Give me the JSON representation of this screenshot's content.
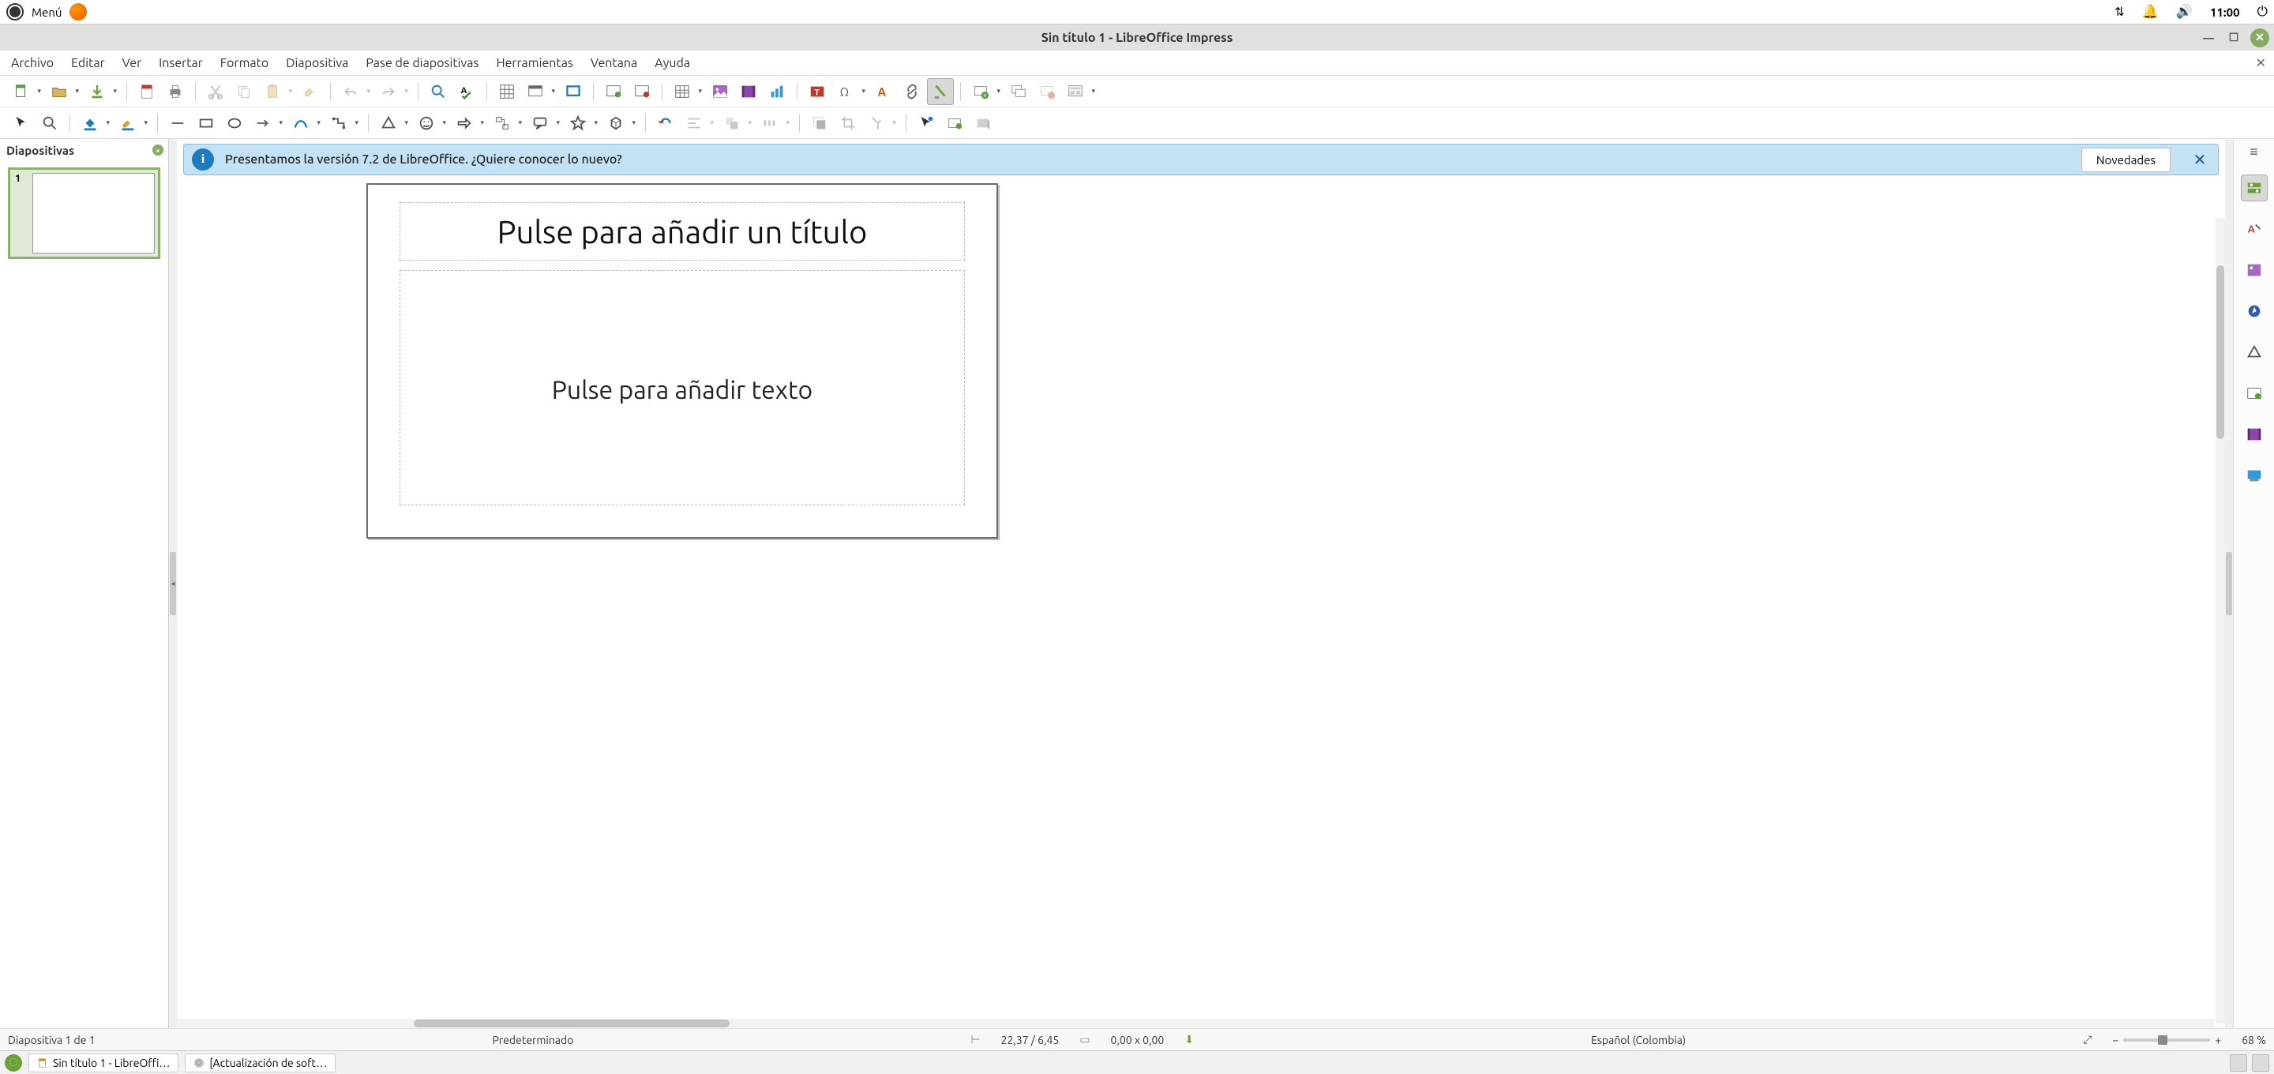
{
  "system": {
    "menu_label": "Menú",
    "clock": "11:00"
  },
  "window": {
    "title": "Sin título 1 - LibreOffice Impress"
  },
  "menus": [
    "Archivo",
    "Editar",
    "Ver",
    "Insertar",
    "Formato",
    "Diapositiva",
    "Pase de diapositivas",
    "Herramientas",
    "Ventana",
    "Ayuda"
  ],
  "slidepanel": {
    "header": "Diapositivas",
    "slides": [
      {
        "num": "1"
      }
    ]
  },
  "infobar": {
    "text": "Presentamos la versión 7.2 de LibreOffice. ¿Quiere conocer lo nuevo?",
    "button": "Novedades"
  },
  "canvas": {
    "title_placeholder": "Pulse para añadir un título",
    "body_placeholder": "Pulse para añadir texto"
  },
  "statusbar": {
    "slideinfo": "Diapositiva 1 de 1",
    "template": "Predeterminado",
    "pos": "22,37 / 6,45",
    "size": "0,00 x 0,00",
    "lang": "Español (Colombia)",
    "zoom": "68 %"
  },
  "taskbar": {
    "tasks": [
      "Sin título 1 - LibreOffi…",
      "[Actualización de soft…"
    ]
  }
}
